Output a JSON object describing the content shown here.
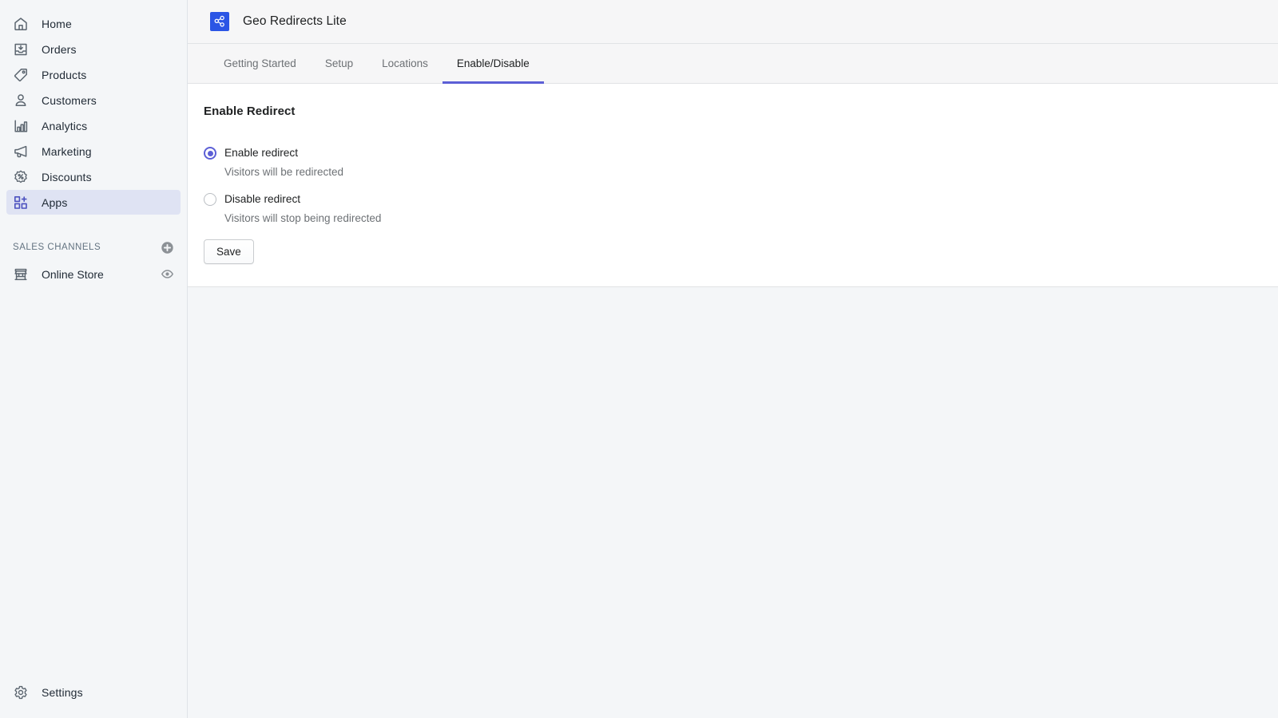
{
  "theme": {
    "accent": "#5c5fd6",
    "logo_bg": "#2b55e5",
    "sidebar_bg": "#f4f6f8",
    "header_bg": "#f6f6f7",
    "card_bg": "#ffffff",
    "border": "#e1e3e5",
    "text_primary": "#202223",
    "text_subdued": "#6d7175",
    "active_nav_bg": "#dfe3f3"
  },
  "sidebar": {
    "items": [
      {
        "label": "Home",
        "icon": "home-icon",
        "active": false
      },
      {
        "label": "Orders",
        "icon": "orders-icon",
        "active": false
      },
      {
        "label": "Products",
        "icon": "products-icon",
        "active": false
      },
      {
        "label": "Customers",
        "icon": "customers-icon",
        "active": false
      },
      {
        "label": "Analytics",
        "icon": "analytics-icon",
        "active": false
      },
      {
        "label": "Marketing",
        "icon": "marketing-icon",
        "active": false
      },
      {
        "label": "Discounts",
        "icon": "discounts-icon",
        "active": false
      },
      {
        "label": "Apps",
        "icon": "apps-icon",
        "active": true
      }
    ],
    "sales_channels": {
      "title": "SALES CHANNELS",
      "add_icon": "plus-circle-icon",
      "channels": [
        {
          "label": "Online Store",
          "icon": "storefront-icon",
          "action_icon": "eye-icon"
        }
      ]
    },
    "footer": {
      "label": "Settings",
      "icon": "gear-icon"
    }
  },
  "app": {
    "title": "Geo Redirects Lite",
    "logo_icon": "share-nodes-icon"
  },
  "tabs": [
    {
      "label": "Getting Started",
      "active": false
    },
    {
      "label": "Setup",
      "active": false
    },
    {
      "label": "Locations",
      "active": false
    },
    {
      "label": "Enable/Disable",
      "active": true
    }
  ],
  "main": {
    "card_title": "Enable Redirect",
    "options": [
      {
        "label": "Enable redirect",
        "help": "Visitors will be redirected",
        "selected": true
      },
      {
        "label": "Disable redirect",
        "help": "Visitors will stop being redirected",
        "selected": false
      }
    ],
    "save_label": "Save"
  }
}
